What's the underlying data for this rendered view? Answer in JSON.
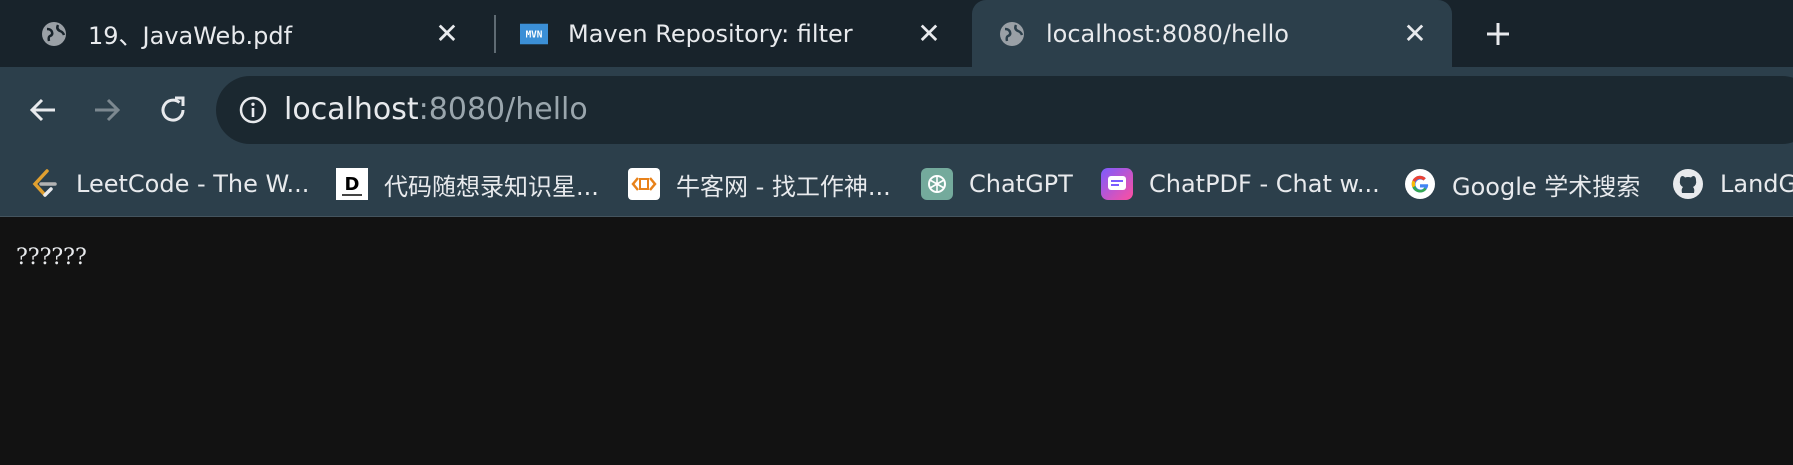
{
  "tabs": [
    {
      "title": "19、JavaWeb.pdf",
      "favicon": "globe-icon"
    },
    {
      "title": "Maven Repository: filter",
      "favicon": "maven-icon"
    },
    {
      "title": "localhost:8080/hello",
      "favicon": "globe-icon",
      "active": true
    }
  ],
  "address_bar": {
    "host": "localhost",
    "rest": ":8080/hello"
  },
  "bookmarks": [
    {
      "label": "LeetCode - The W...",
      "icon": "leetcode-icon"
    },
    {
      "label": "代码随想录知识星...",
      "icon": "daimasuixianglu-icon"
    },
    {
      "label": "牛客网 - 找工作神...",
      "icon": "nowcoder-icon"
    },
    {
      "label": "ChatGPT",
      "icon": "chatgpt-icon"
    },
    {
      "label": "ChatPDF - Chat w...",
      "icon": "chatpdf-icon"
    },
    {
      "label": "Google 学术搜索",
      "icon": "google-icon"
    },
    {
      "label": "LandG",
      "icon": "github-icon"
    }
  ],
  "page": {
    "body_text": "??????"
  },
  "colors": {
    "tab_strip": "#18232b",
    "toolbar": "#2c3f4b",
    "omnibox": "#1b2830",
    "page_background": "#121212"
  }
}
